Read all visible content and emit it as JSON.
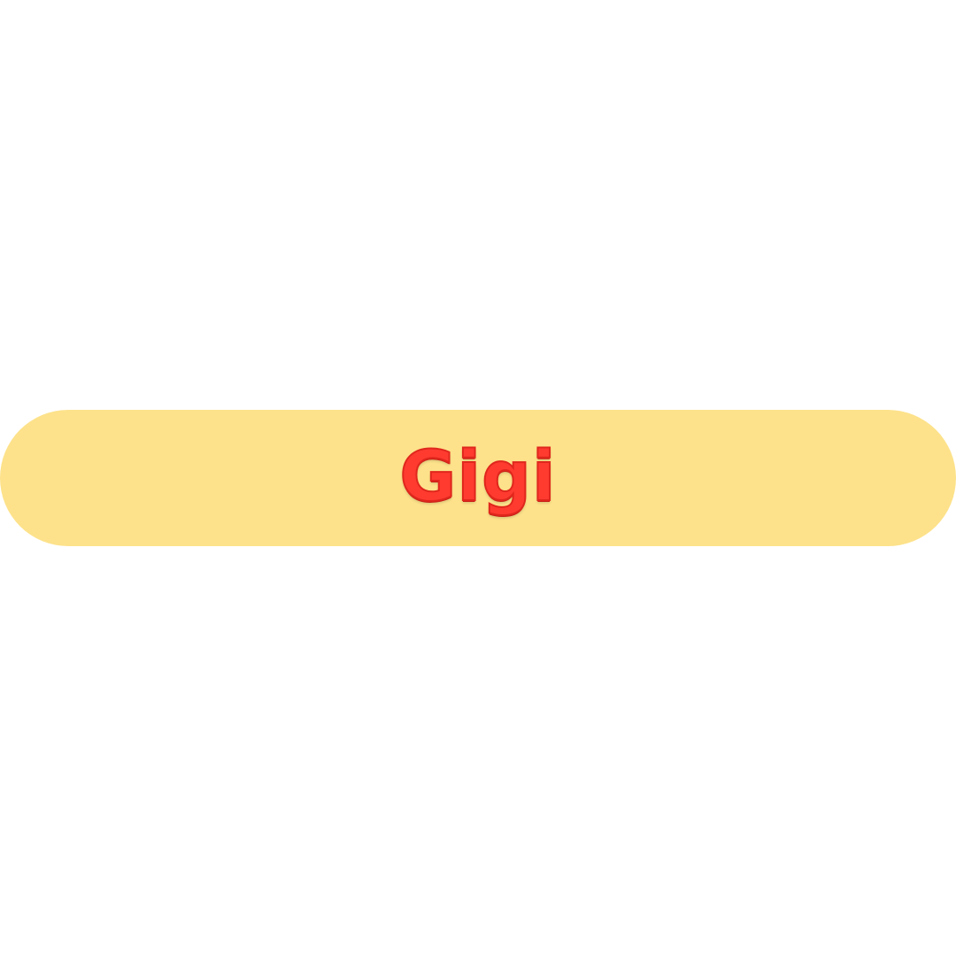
{
  "banner": {
    "text": "Gigi",
    "background_color": "#fde28b",
    "text_color": "#ff3b30"
  }
}
